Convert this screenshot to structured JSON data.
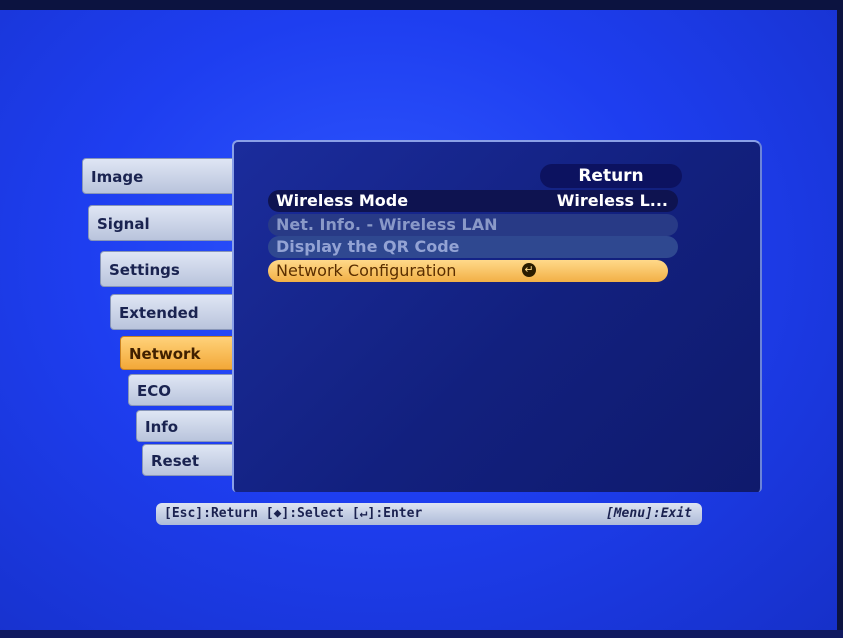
{
  "menu": {
    "tabs": [
      {
        "label": "Image"
      },
      {
        "label": "Signal"
      },
      {
        "label": "Settings"
      },
      {
        "label": "Extended"
      },
      {
        "label": "Network"
      },
      {
        "label": "ECO"
      },
      {
        "label": "Info"
      },
      {
        "label": "Reset"
      }
    ],
    "active_tab": "Network"
  },
  "panel": {
    "return_label": "Return",
    "items": [
      {
        "label": "Wireless Mode",
        "value": "Wireless L..."
      },
      {
        "label": "Net. Info. - Wireless LAN"
      },
      {
        "label": "Display the QR Code"
      },
      {
        "label": "Network Configuration",
        "icon": "enter-icon"
      }
    ]
  },
  "helpbar": {
    "left_text": "[Esc]:Return [◆]:Select [↵]:Enter",
    "right_text": "[Menu]:Exit"
  },
  "colors": {
    "background": "#1e3ef0",
    "panel": "#12207e",
    "highlight": "#f2b046",
    "tab_active": "#f3a838"
  }
}
